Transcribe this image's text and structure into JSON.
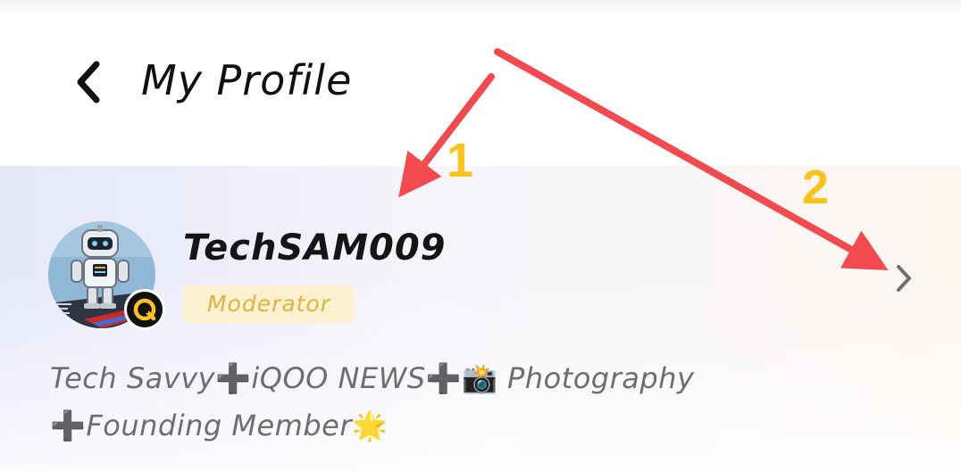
{
  "header": {
    "title": "My Profile",
    "back_icon": "chevron-left-icon"
  },
  "profile": {
    "username": "TechSAM009",
    "role": "Moderator",
    "avatar_icon": "robot-avatar",
    "badge_icon": "iqoo-logo-icon",
    "chevron_icon": "chevron-right-icon",
    "bio_line1": {
      "part1": "Tech Savvy",
      "plus1": "➕",
      "part2": "iQOO NEWS",
      "plus2": "➕",
      "camera": "📸",
      "part3": " Photography"
    },
    "bio_line2": {
      "plus": "➕",
      "part1": "Founding Member",
      "star": "🌟"
    }
  },
  "annotations": {
    "label1": "1",
    "label2": "2",
    "arrow_color": "#f24a4f",
    "label_color": "#ffc21a"
  },
  "colors": {
    "role_badge_bg": "#fdf1d0",
    "role_badge_text": "#e0b240",
    "bio_text": "#6e6e6e"
  }
}
